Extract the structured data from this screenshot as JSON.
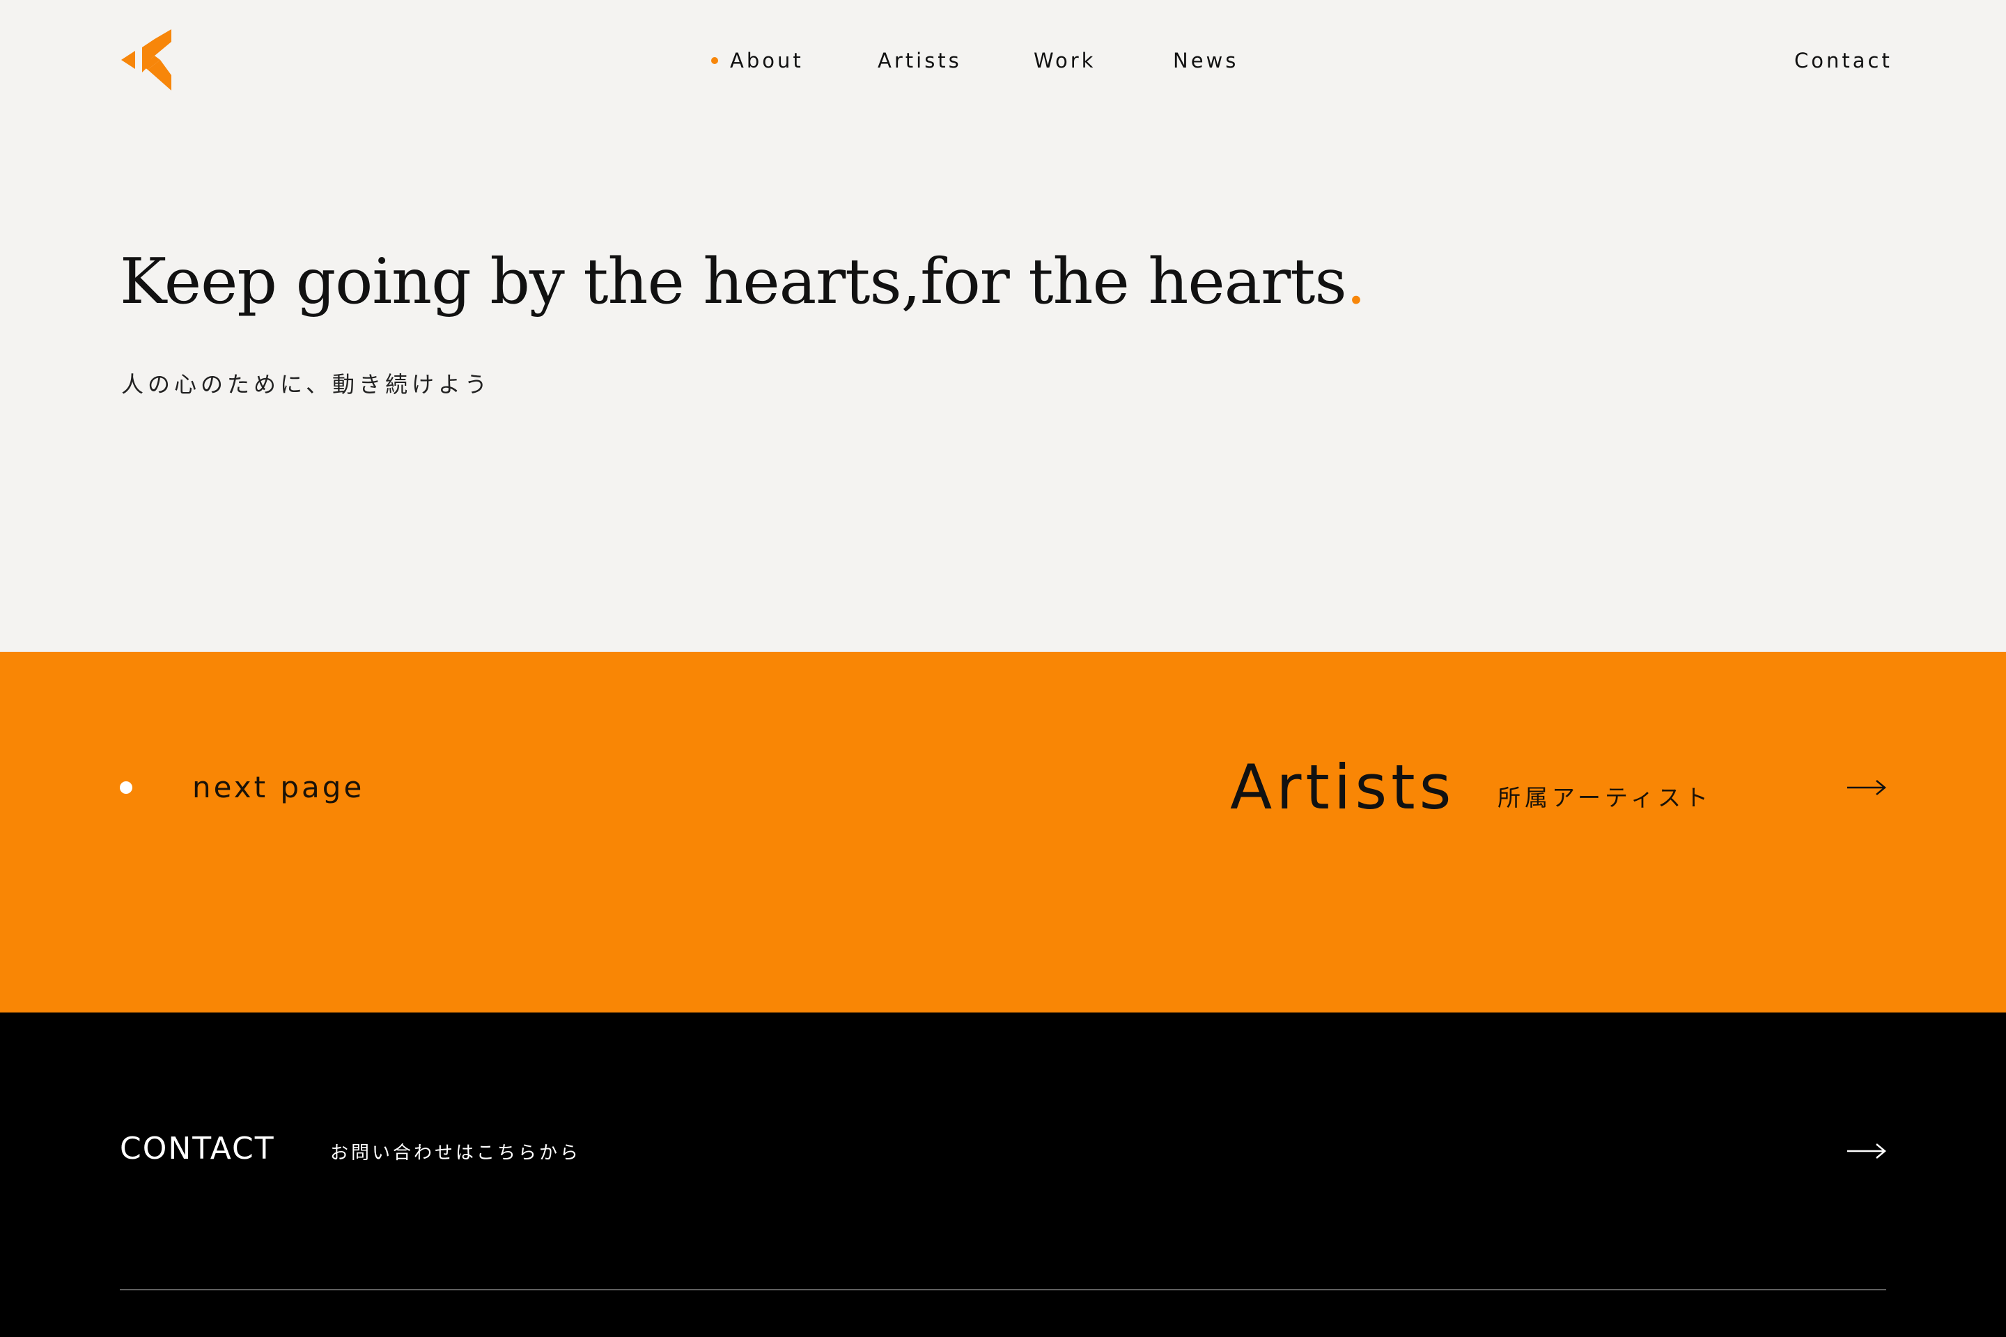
{
  "brand": {
    "logo_icon": "chevron-k-logo",
    "accent_color": "#f98605"
  },
  "nav": {
    "items": [
      {
        "label": "About",
        "active": true
      },
      {
        "label": "Artists"
      },
      {
        "label": "Work"
      },
      {
        "label": "News"
      }
    ],
    "contact_label": "Contact"
  },
  "hero": {
    "title": "Keep going by the hearts,for the hearts",
    "title_period": ".",
    "subtitle": "人の心のために、動き続けよう"
  },
  "next_page": {
    "label": "next page",
    "title": "Artists",
    "subtitle": "所属アーティスト",
    "arrow_icon": "arrow-right-icon"
  },
  "footer": {
    "contact_title": "CONTACT",
    "contact_subtitle": "お問い合わせはこちらから",
    "arrow_icon": "arrow-right-icon"
  }
}
